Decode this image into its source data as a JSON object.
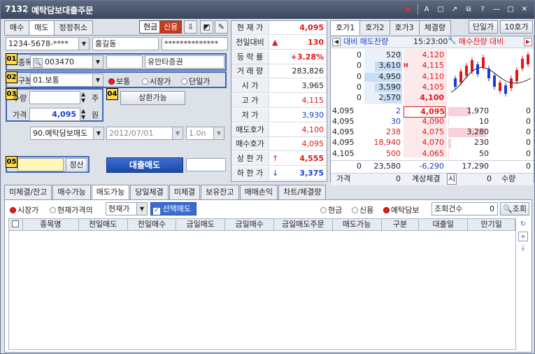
{
  "window": {
    "code": "7132",
    "title": "예탁담보대출주문"
  },
  "titlebar_icons": [
    "play-icon",
    "font-icon",
    "screen-icon",
    "link-icon",
    "copy-icon",
    "help-icon",
    "minimize-icon",
    "maximize-icon",
    "close-icon"
  ],
  "order": {
    "tabs": [
      "매수",
      "매도",
      "정정취소"
    ],
    "active_tab": "매도",
    "cash_label": "현금",
    "credit_label": "신용",
    "account": "1234-5678-****",
    "account_name": "홍길동",
    "password": "**************",
    "stock_label": "종목",
    "stock_code": "003470",
    "stock_name": "유안타증권",
    "type_label": "구분",
    "type_value": "01.보통",
    "radio_normal": "보통",
    "radio_market": "시장가",
    "radio_single": "단일가",
    "qty_label": "수량",
    "qty_unit": "주",
    "repay_button": "상환가능",
    "price_label": "가격",
    "price_value": "4,095",
    "price_unit": "원",
    "loan_type": "90.예탁담보매도",
    "loan_date": "2012/07/01",
    "loan_term": "1.0n",
    "settle_button": "정산",
    "submit_button": "대출매도",
    "badges": [
      "01",
      "02",
      "03",
      "04",
      "05"
    ]
  },
  "quote": {
    "rows": [
      {
        "label": "현 재 가",
        "value": "4,095",
        "color": "red",
        "bold": true
      },
      {
        "label": "전일대비",
        "value": "130",
        "color": "red",
        "bold": true,
        "arrow": "▲"
      },
      {
        "label": "등 락 률",
        "value": "+3.28%",
        "color": "red",
        "bold": true
      },
      {
        "label": "거 래 량",
        "value": "283,826",
        "color": "black"
      },
      {
        "label": "시   가",
        "value": "3,965",
        "color": "black"
      },
      {
        "label": "고   가",
        "value": "4,115",
        "color": "red"
      },
      {
        "label": "저   가",
        "value": "3,930",
        "color": "blue"
      },
      {
        "label": "매도호가",
        "value": "4,100",
        "color": "red"
      },
      {
        "label": "매수호가",
        "value": "4,095",
        "color": "red"
      },
      {
        "label": "상 한 가",
        "value": "4,555",
        "color": "red",
        "bold": true,
        "arrow": "↑"
      },
      {
        "label": "하 한 가",
        "value": "3,375",
        "color": "blue",
        "bold": true,
        "arrow": "↓"
      }
    ]
  },
  "orderbook": {
    "tabs": [
      "호가1",
      "호가2",
      "호가3",
      "체결량"
    ],
    "single_price_button": "단일가",
    "ten_button": "10호가",
    "header": {
      "left": "대비 매도잔량",
      "time": "15:23:00",
      "right": "매수잔량 대비"
    },
    "asks": [
      {
        "diff": "0",
        "qty": "520",
        "price": "4,120"
      },
      {
        "diff": "0",
        "qty": "3,610",
        "price": "4,115"
      },
      {
        "diff": "0",
        "qty": "4,950",
        "price": "4,110"
      },
      {
        "diff": "0",
        "qty": "3,590",
        "price": "4,105"
      },
      {
        "diff": "0",
        "qty": "2,570",
        "price": "4,100"
      }
    ],
    "ask_qty_fill": [
      0.11,
      0.73,
      1.0,
      0.73,
      0.52
    ],
    "bids": [
      {
        "exec": "4,095",
        "exec_qty": "2",
        "price": "4,095",
        "qty": "1,970",
        "diff": "0"
      },
      {
        "exec": "4,095",
        "exec_qty": "30",
        "price": "4,090",
        "qty": "10",
        "diff": "0"
      },
      {
        "exec": "4,095",
        "exec_qty": "238",
        "price": "4,075",
        "qty": "3,280",
        "diff": "0"
      },
      {
        "exec": "4,095",
        "exec_qty": "18,940",
        "price": "4,070",
        "qty": "230",
        "diff": "0"
      },
      {
        "exec": "4,105",
        "exec_qty": "500",
        "price": "4,065",
        "qty": "50",
        "diff": "0"
      }
    ],
    "total": {
      "diff_left": "0",
      "ask_total": "23,580",
      "diff": "-6,290",
      "bid_total": "17,290",
      "diff_right": "0"
    },
    "footer": {
      "price_label": "가격",
      "price_value": "0",
      "expected_label": "계상체결",
      "btn": "시",
      "qty_value": "0",
      "qty_label": "수량"
    },
    "high_marker": "H"
  },
  "bottom": {
    "tabs": [
      "미체결/잔고",
      "매수가능",
      "매도가능",
      "당일체결",
      "미체결",
      "보유잔고",
      "매매손익",
      "차트/체결량"
    ],
    "active_tab": "매도가능",
    "radio_market": "시장가",
    "radio_current": "현재가격의",
    "price_select": "현재가",
    "checkbox_label": "선택매도",
    "radio_cash": "현금",
    "radio_credit": "신용",
    "radio_deposit": "예탁담보",
    "query_count_label": "조회건수",
    "query_count": "0",
    "query_button": "조회",
    "columns": [
      "종목명",
      "전일매도",
      "전일매수",
      "금일매도",
      "금일매수",
      "금일매도주문",
      "매도가능",
      "구분",
      "대출일",
      "만기일"
    ]
  },
  "colors": {
    "accent_red": "#e01818",
    "accent_blue": "#1a3fd0",
    "titlebar": "#3b475c",
    "submit_blue": "#1d4aa8"
  }
}
